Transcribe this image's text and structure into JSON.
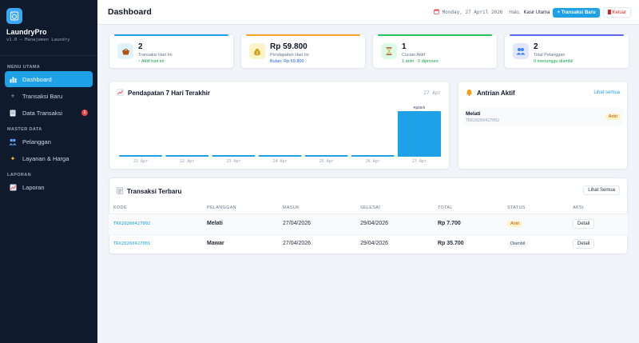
{
  "brand": {
    "name": "LaundryPro",
    "subtitle": "v1.0 — Manajemen Laundry"
  },
  "nav": {
    "menu_utama": "MENU UTAMA",
    "dashboard": "Dashboard",
    "transaksi_baru": "Transaksi Baru",
    "data_transaksi": "Data Transaksi",
    "data_transaksi_badge": "1",
    "master_data": "MASTER DATA",
    "pelanggan": "Pelanggan",
    "layanan": "Layanan & Harga",
    "laporan_section": "LAPORAN",
    "laporan": "Laporan"
  },
  "header": {
    "title": "Dashboard",
    "date": "Monday, 27 April 2026",
    "greeting_prefix": "Halo,",
    "user": "Kasir Utama",
    "new_button": "+ Transaksi Baru",
    "logout_button": "Keluar"
  },
  "stats": [
    {
      "value": "2",
      "label": "Transaksi Hari Ini",
      "sub": "↑ Aktif hari ini",
      "accent": "#1ea1e6",
      "icon": "basket-icon"
    },
    {
      "value": "Rp 59.800",
      "label": "Pendapatan Hari Ini",
      "sub": "Bulan: Rp 59.800",
      "accent": "#f5a524",
      "icon": "money-bag-icon"
    },
    {
      "value": "1",
      "label": "Cucian Aktif",
      "sub_a": "1 antri",
      "sub_b": "0 diproses",
      "accent": "#22c55e",
      "icon": "hourglass-icon"
    },
    {
      "value": "2",
      "label": "Total Pelanggan",
      "sub": "0 menunggu diambil",
      "accent": "#6366f1",
      "icon": "people-icon"
    }
  ],
  "revenue": {
    "title": "Pendapatan 7 Hari Terakhir",
    "date_label": "27 Apr"
  },
  "chart_data": {
    "type": "bar",
    "categories": [
      "21 Apr",
      "22 Apr",
      "23 Apr",
      "24 Apr",
      "25 Apr",
      "26 Apr",
      "27 Apr"
    ],
    "values": [
      0,
      0,
      0,
      0,
      0,
      0,
      59800
    ],
    "data_labels": [
      "",
      "",
      "",
      "",
      "",
      "",
      "Rp60rb"
    ],
    "title": "Pendapatan 7 Hari Terakhir",
    "xlabel": "",
    "ylabel": "",
    "ylim": [
      0,
      59800
    ],
    "grid": false,
    "color": "#1ea1e6"
  },
  "queue": {
    "title": "Antrian Aktif",
    "link": "Lihat semua",
    "items": [
      {
        "name": "Melati",
        "code": "TRX20260427002",
        "status": "Antri"
      }
    ]
  },
  "recent": {
    "title": "Transaksi Terbaru",
    "view_all": "Lihat Semua",
    "columns": [
      "KODE",
      "PELANGGAN",
      "MASUK",
      "SELESAI",
      "TOTAL",
      "STATUS",
      "AKSI"
    ],
    "rows": [
      {
        "kode": "TRX20260427002",
        "pelanggan": "Melati",
        "masuk": "27/04/2026",
        "selesai": "29/04/2026",
        "total": "Rp 7.700",
        "status": "Antri",
        "aksi": "Detail"
      },
      {
        "kode": "TRX20260427001",
        "pelanggan": "Mawar",
        "masuk": "27/04/2026",
        "selesai": "29/04/2026",
        "total": "Rp 35.700",
        "status": "Diambil",
        "aksi": "Detail"
      }
    ]
  },
  "colors": {
    "primary": "#1ea1e6",
    "sidebar": "#0f1b2d",
    "danger": "#ef4444",
    "warning_bg": "#fef3c7",
    "warning_fg": "#b45309"
  }
}
